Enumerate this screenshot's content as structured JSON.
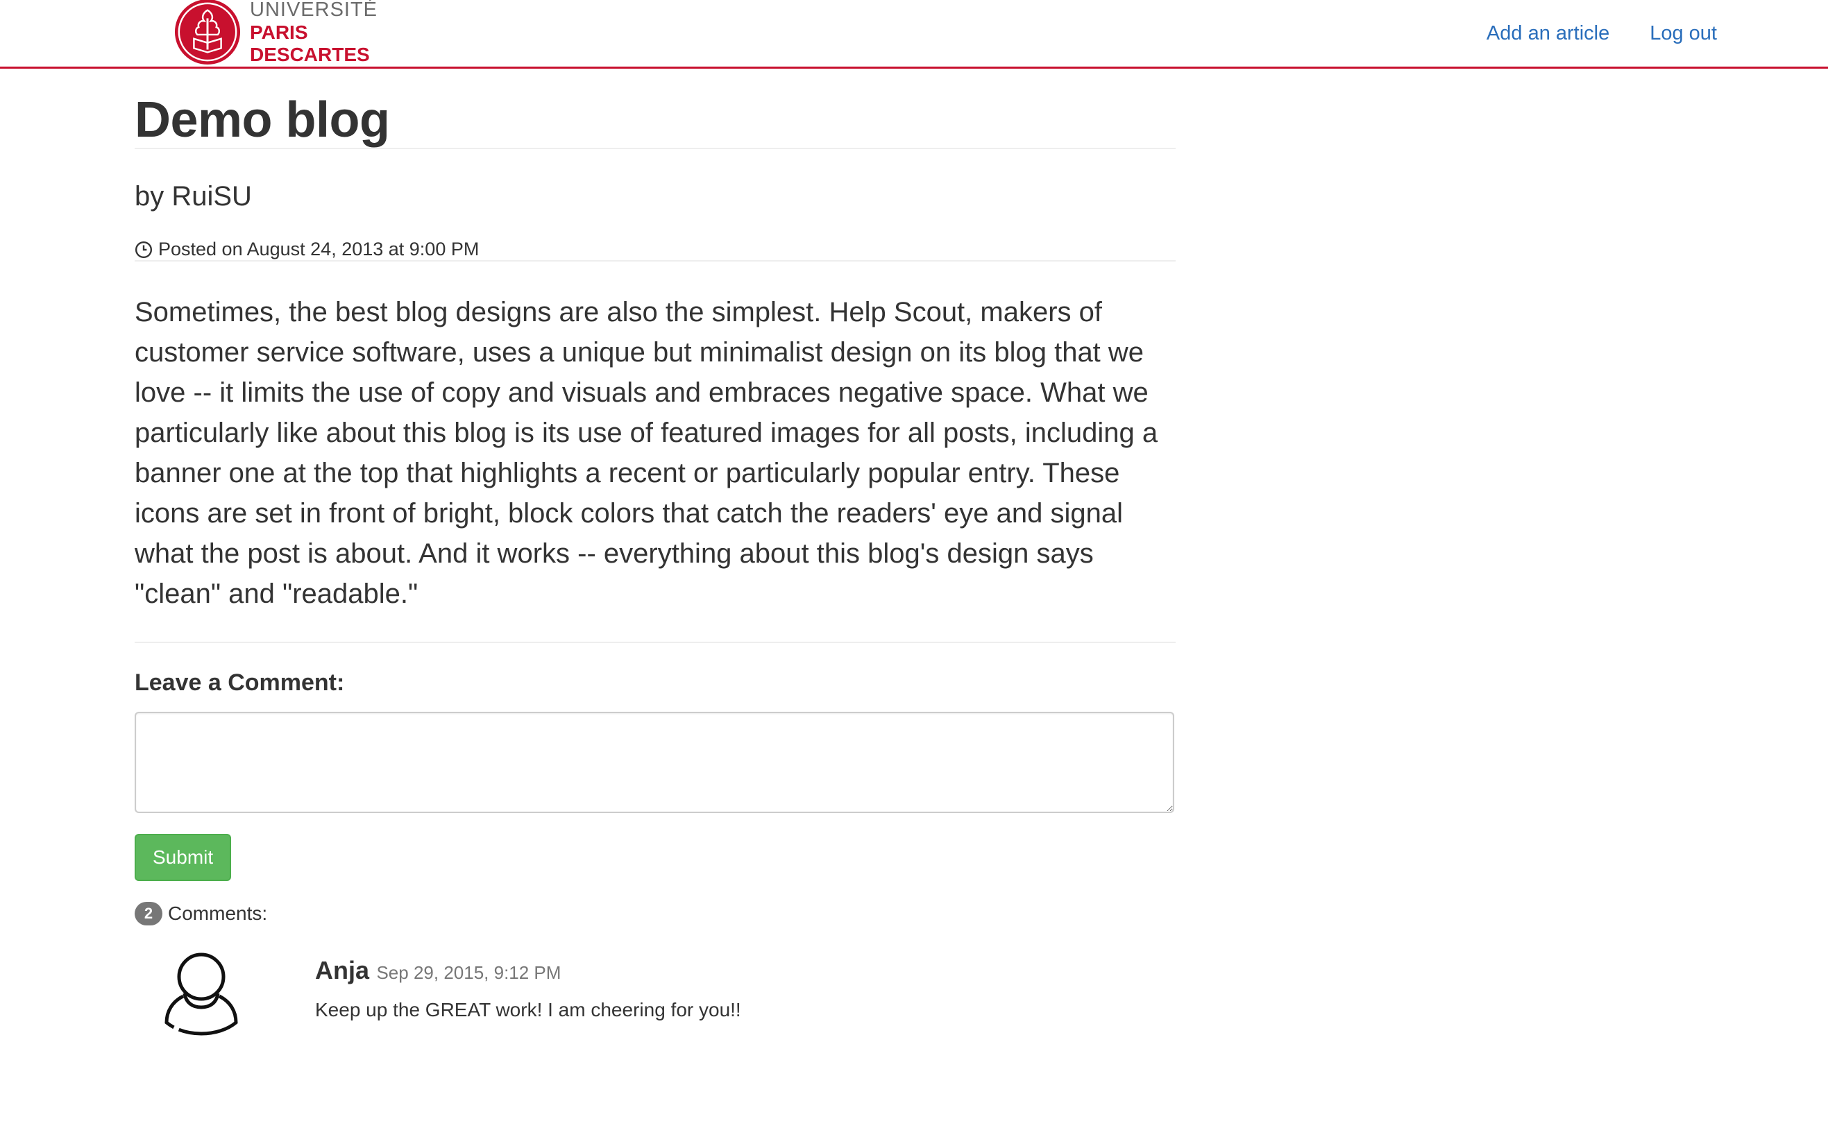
{
  "header": {
    "logo": {
      "line1": "UNIVERSITÉ",
      "line2": "PARIS",
      "line3": "DESCARTES"
    },
    "nav": [
      {
        "label": "Add an article"
      },
      {
        "label": "Log out"
      }
    ]
  },
  "post": {
    "title": "Demo blog",
    "author": "by RuiSU",
    "posted": "Posted on August 24, 2013 at 9:00 PM",
    "body": "Sometimes, the best blog designs are also the simplest. Help Scout, makers of customer service software, uses a unique but minimalist design on its blog that we love -- it limits the use of copy and visuals and embraces negative space. What we particularly like about this blog is its use of featured images for all posts, including a banner one at the top that highlights a recent or particularly popular entry. These icons are set in front of bright, block colors that catch the readers' eye and signal what the post is about. And it works -- everything about this blog's design says \"clean\" and \"readable.\""
  },
  "comment_form": {
    "heading": "Leave a Comment:",
    "value": "",
    "submit_label": "Submit"
  },
  "comments": {
    "count": "2",
    "label": "Comments:",
    "items": [
      {
        "author": "Anja",
        "date": "Sep 29, 2015, 9:12 PM",
        "text": "Keep up the GREAT work! I am cheering for you!!",
        "avatar_icon": "user-outline-icon"
      }
    ]
  },
  "colors": {
    "brand_red": "#c8102e",
    "link_blue": "#2a6ebb",
    "submit_green": "#5cb85c",
    "badge_gray": "#777777"
  },
  "icons": {
    "logo": "university-seal-icon",
    "posted": "clock-icon"
  }
}
